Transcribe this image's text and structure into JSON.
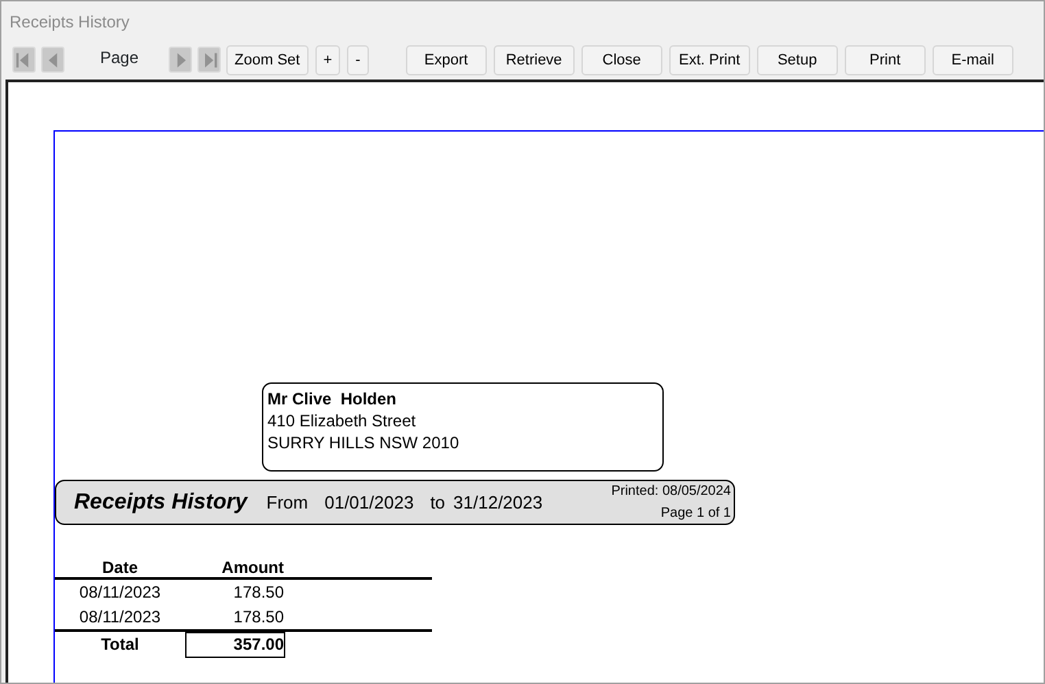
{
  "window": {
    "title": "Receipts History"
  },
  "toolbar": {
    "nav_buttons": [
      {
        "kind": "first",
        "disabled": true
      },
      {
        "kind": "prev",
        "disabled": true
      },
      {
        "kind": "next",
        "disabled": true
      },
      {
        "kind": "last",
        "disabled": true
      }
    ],
    "page_label": "Page",
    "buttons": [
      {
        "label": "Zoom Set",
        "kind": "zoom"
      },
      {
        "label": "+",
        "kind": "zoom"
      },
      {
        "label": "-",
        "kind": "zoom"
      },
      {
        "label": "Export",
        "kind": "action"
      },
      {
        "label": "Retrieve",
        "kind": "action"
      },
      {
        "label": "Close",
        "kind": "action"
      },
      {
        "label": "Ext. Print",
        "kind": "action"
      },
      {
        "label": "Setup",
        "kind": "action"
      },
      {
        "label": "Print",
        "kind": "action"
      },
      {
        "label": "E-mail",
        "kind": "action"
      }
    ]
  },
  "report": {
    "address": [
      "Mr Clive  Holden",
      "410 Elizabeth Street",
      "SURRY HILLS NSW 2010"
    ],
    "header": {
      "title": "Receipts History",
      "from_label": "From",
      "from_date": "01/01/2023",
      "to_label": "to",
      "to_date": "31/12/2023",
      "printed": "Printed: 08/05/2024",
      "page": "Page 1 of 1"
    },
    "table": {
      "columns": [
        "Date",
        "Amount"
      ],
      "rows": [
        [
          "08/11/2023",
          "178.50"
        ],
        [
          "08/11/2023",
          "178.50"
        ]
      ],
      "total_label": "Total",
      "total": "357.00"
    }
  }
}
